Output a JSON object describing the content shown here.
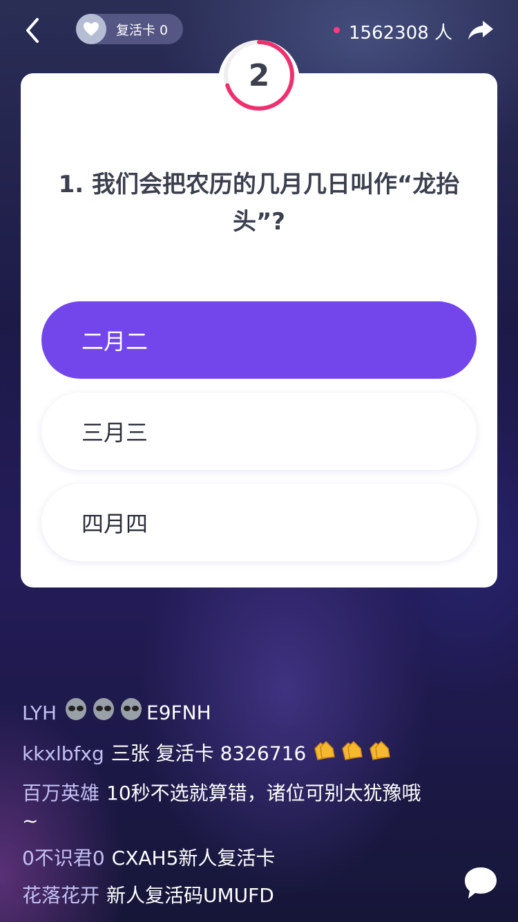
{
  "header": {
    "revive_label": "复活卡 0",
    "viewer_count": "1562308 人",
    "accent_color": "#ff3d7f"
  },
  "quiz": {
    "timer_value": "2",
    "timer_remaining_fraction": 0.7,
    "question": "1. 我们会把农历的几月几日叫作“龙抬头”?",
    "options": [
      {
        "label": "二月二",
        "selected": true
      },
      {
        "label": "三月三",
        "selected": false
      },
      {
        "label": "四月四",
        "selected": false
      }
    ],
    "selected_color": "#7346ec"
  },
  "chat": [
    {
      "name": "LYH",
      "emoji": "alien-emoji x3",
      "message": "E9FNH"
    },
    {
      "name": "kkxlbfxg",
      "message": "三张 复活卡  8326716",
      "emoji": "clapping-emoji x3"
    },
    {
      "name": "百万英雄",
      "message": "10秒不选就算错，诸位可别太犹豫哦~"
    },
    {
      "name": "0不识君0",
      "message": "CXAH5新人复活卡"
    },
    {
      "name": "花落花开",
      "message": "新人复活码UMUFD"
    }
  ],
  "icons": {
    "back": "chevron-left-icon",
    "revive": "heart-icon",
    "share": "share-arrow-icon",
    "chat": "chat-bubble-icon"
  }
}
